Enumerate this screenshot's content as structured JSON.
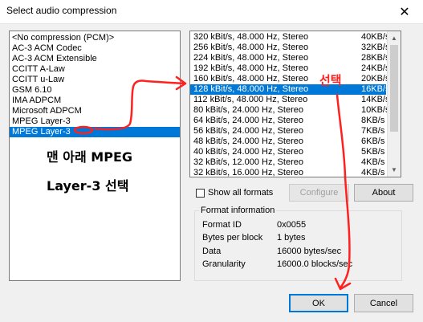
{
  "window": {
    "title": "Select audio compression",
    "close_glyph": "✕"
  },
  "codecs": {
    "items": [
      "<No compression (PCM)>",
      "AC-3 ACM Codec",
      "AC-3 ACM Extensible",
      "CCITT A-Law",
      "CCITT u-Law",
      "GSM 6.10",
      "IMA ADPCM",
      "Microsoft ADPCM",
      "MPEG Layer-3",
      "MPEG Layer-3"
    ],
    "selected_index": 9
  },
  "formats": {
    "rows": [
      {
        "format": "320 kBit/s, 48.000 Hz, Stereo",
        "rate": "40KB/s"
      },
      {
        "format": "256 kBit/s, 48.000 Hz, Stereo",
        "rate": "32KB/s"
      },
      {
        "format": "224 kBit/s, 48.000 Hz, Stereo",
        "rate": "28KB/s"
      },
      {
        "format": "192 kBit/s, 48.000 Hz, Stereo",
        "rate": "24KB/s"
      },
      {
        "format": "160 kBit/s, 48.000 Hz, Stereo",
        "rate": "20KB/s"
      },
      {
        "format": "128 kBit/s, 48.000 Hz, Stereo",
        "rate": "16KB/s"
      },
      {
        "format": "112 kBit/s, 48.000 Hz, Stereo",
        "rate": "14KB/s"
      },
      {
        "format": "80 kBit/s, 24.000 Hz, Stereo",
        "rate": "10KB/s"
      },
      {
        "format": "64 kBit/s, 24.000 Hz, Stereo",
        "rate": "8KB/s"
      },
      {
        "format": "56 kBit/s, 24.000 Hz, Stereo",
        "rate": "7KB/s"
      },
      {
        "format": "48 kBit/s, 24.000 Hz, Stereo",
        "rate": "6KB/s"
      },
      {
        "format": "40 kBit/s, 24.000 Hz, Stereo",
        "rate": "5KB/s"
      },
      {
        "format": "32 kBit/s, 12.000 Hz, Stereo",
        "rate": "4KB/s"
      },
      {
        "format": "32 kBit/s, 16.000 Hz, Stereo",
        "rate": "4KB/s"
      }
    ],
    "selected_index": 5
  },
  "controls": {
    "show_all_formats": "Show all formats",
    "configure": "Configure",
    "about": "About",
    "ok": "OK",
    "cancel": "Cancel"
  },
  "format_info": {
    "title": "Format information",
    "rows": [
      {
        "label": "Format ID",
        "value": "0x0055"
      },
      {
        "label": "Bytes per block",
        "value": "1 bytes"
      },
      {
        "label": "Data",
        "value": "16000 bytes/sec"
      },
      {
        "label": "Granularity",
        "value": "16000.0 blocks/sec"
      }
    ]
  },
  "annotations": {
    "line1": "맨 아래 MPEG",
    "line2": "Layer-3 선택",
    "select_label": "선택",
    "color": "#ff2020"
  },
  "colors": {
    "selection": "#0078d7",
    "default_button": "#0078d7"
  }
}
